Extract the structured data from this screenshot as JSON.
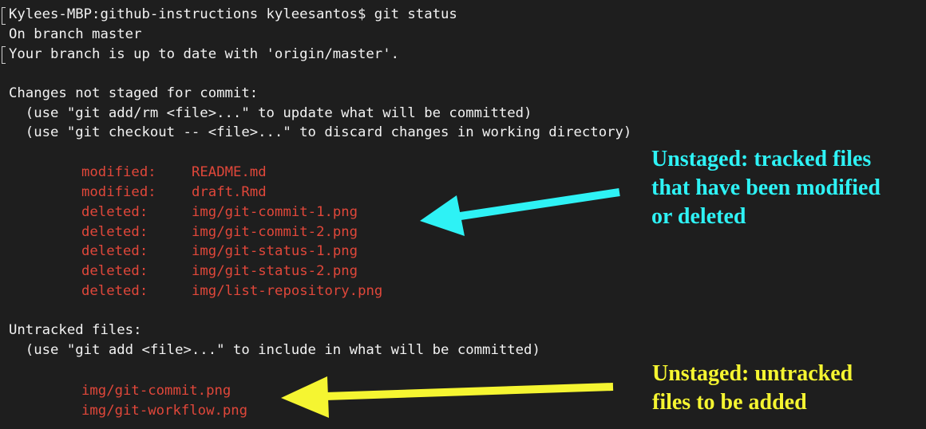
{
  "terminal": {
    "prompt": "Kylees-MBP:github-instructions kyleesantos$ git status",
    "branch_line": "On branch master",
    "up_to_date_line": "Your branch is up to date with 'origin/master'.",
    "not_staged_header": "Changes not staged for commit:",
    "hint_add_rm": "  (use \"git add/rm <file>...\" to update what will be committed)",
    "hint_checkout": "  (use \"git checkout -- <file>...\" to discard changes in working directory)",
    "changes": [
      {
        "status": "modified:",
        "file": "README.md"
      },
      {
        "status": "modified:",
        "file": "draft.Rmd"
      },
      {
        "status": "deleted:",
        "file": "img/git-commit-1.png"
      },
      {
        "status": "deleted:",
        "file": "img/git-commit-2.png"
      },
      {
        "status": "deleted:",
        "file": "img/git-status-1.png"
      },
      {
        "status": "deleted:",
        "file": "img/git-status-2.png"
      },
      {
        "status": "deleted:",
        "file": "img/list-repository.png"
      }
    ],
    "untracked_header": "Untracked files:",
    "hint_add": "  (use \"git add <file>...\" to include in what will be committed)",
    "untracked": [
      "img/git-commit.png",
      "img/git-workflow.png"
    ]
  },
  "annotations": {
    "unstaged_tracked": [
      "Unstaged: tracked files",
      "that have been modified",
      "or deleted"
    ],
    "unstaged_untracked": [
      "Unstaged: untracked",
      "files to be added"
    ]
  },
  "colors": {
    "background": "#1e1e1e",
    "text": "#f2f2f2",
    "changed_file": "#e0473a",
    "cyan_annotation": "#2ef2f5",
    "yellow_annotation": "#f5f531"
  }
}
